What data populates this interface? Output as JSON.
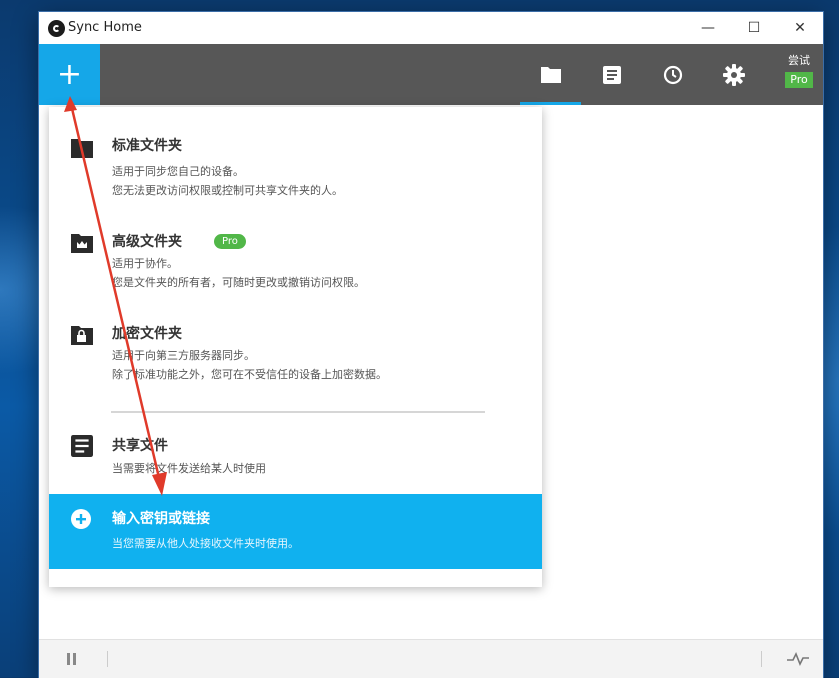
{
  "window": {
    "title": "Sync Home",
    "controls": {
      "minimize": "—",
      "maximize": "☐",
      "close": "✕"
    }
  },
  "toolbar": {
    "add_label": "+",
    "tabs": [
      {
        "name": "folders",
        "icon": "folder-icon",
        "active": true
      },
      {
        "name": "transfers",
        "icon": "document-list-icon",
        "active": false
      },
      {
        "name": "history",
        "icon": "clock-icon",
        "active": false
      },
      {
        "name": "settings",
        "icon": "gear-icon",
        "active": false
      }
    ],
    "trial_label": "尝试",
    "trial_badge": "Pro"
  },
  "menu": {
    "items": [
      {
        "title": "标准文件夹",
        "icon": "folder-icon",
        "desc": [
          "适用于同步您自己的设备。",
          "您无法更改访问权限或控制可共享文件夹的人。"
        ]
      },
      {
        "title": "高级文件夹",
        "icon": "crown-folder-icon",
        "badge": "Pro",
        "desc": [
          "适用于协作。",
          "您是文件夹的所有者，可随时更改或撤销访问权限。"
        ]
      },
      {
        "title": "加密文件夹",
        "icon": "lock-folder-icon",
        "desc": [
          "适用于向第三方服务器同步。",
          "除了标准功能之外，您可在不受信任的设备上加密数据。"
        ]
      },
      {
        "title": "共享文件",
        "icon": "document-icon",
        "desc": [
          "当需要将文件发送给某人时使用"
        ]
      },
      {
        "title": "输入密钥或链接",
        "icon": "plus-circle-icon",
        "highlighted": true,
        "desc": [
          "当您需要从他人处接收文件夹时使用。"
        ]
      }
    ]
  },
  "statusbar": {
    "pause_icon": "pause-icon",
    "activity_icon": "activity-icon"
  },
  "colors": {
    "accent": "#15a7e8",
    "highlight": "#10b1ef",
    "pro_green": "#51b748",
    "toolbar": "#575757",
    "arrow": "#e03a2a"
  }
}
